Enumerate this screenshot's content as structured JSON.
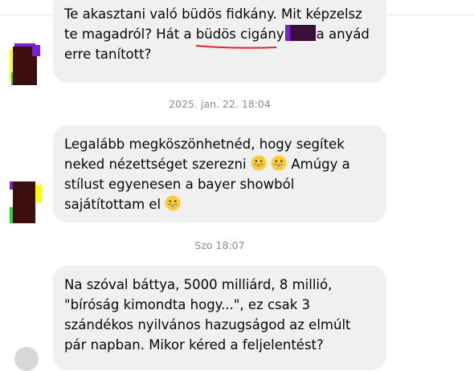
{
  "messages": [
    {
      "lines": [
        "Te akasztani való büdös fidkány. Mit képzelsz",
        "te  magadról? Hát a",
        "a anyád",
        "erre tanított?"
      ],
      "underlined_text": "büdös cigány"
    },
    {
      "lines": [
        "Legalább megköszönhetnéd, hogy segítek",
        "neked nézettséget szerezni",
        "Amúgy a",
        "stílust egyenesen a bayer showból",
        "sajátítottam el"
      ]
    },
    {
      "lines": [
        "Na szóval báttya, 5000 milliárd, 8 millió,",
        "\"bíróság kimondta hogy...\", ez csak 3",
        "szándékos nyilvános hazugságod az elmúlt",
        "pár napban. Mikor kéred a feljelentést?"
      ]
    }
  ],
  "timestamps": [
    "2025. jan. 22. 18:04",
    "Szo 18:07"
  ],
  "colors": {
    "bubble": "#f0f0f0",
    "timestamp": "#8a8d91",
    "underline": "#e0241f",
    "redaction": "#3a0f3a"
  }
}
